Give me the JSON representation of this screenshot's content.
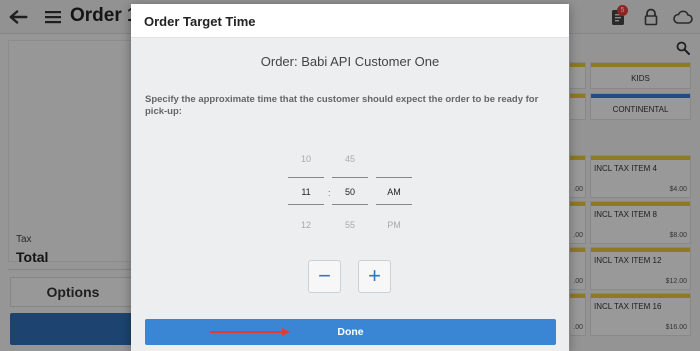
{
  "app": {
    "title": "Order 1",
    "notification_count": "5",
    "icons": [
      "back-arrow-icon",
      "hamburger-menu-icon",
      "clipboard-icon",
      "lock-icon",
      "cloud-icon",
      "search-icon"
    ]
  },
  "left_panel": {
    "tax_label": "Tax",
    "total_label": "Total",
    "options_button": "Options"
  },
  "categories": [
    {
      "name": "KIDS",
      "color": "#e8c33a"
    },
    {
      "name": "CONTINENTAL",
      "color": "#3a7bd5"
    }
  ],
  "items": [
    {
      "name": "INCL TAX ITEM 4",
      "price": "$4.00"
    },
    {
      "name": "INCL TAX ITEM 8",
      "price": "$8.00"
    },
    {
      "name": "INCL TAX ITEM 12",
      "price": "$12.00"
    },
    {
      "name": "INCL TAX ITEM 16",
      "price": "$16.00"
    }
  ],
  "left_partial_prices": [
    ".00",
    ".00",
    ".00",
    ".00"
  ],
  "dialog": {
    "title": "Order Target Time",
    "order_label": "Order: Babi API Customer One",
    "instructions": "Specify the approximate time that the customer should expect the order to be ready for pick-up:",
    "time_picker": {
      "hours": {
        "prev": "10",
        "selected": "11",
        "next": "12"
      },
      "separator": ":",
      "minutes": {
        "prev": "45",
        "selected": "50",
        "next": "55"
      },
      "period": {
        "prev": "",
        "selected": "AM",
        "next": "PM"
      }
    },
    "decrement_label": "−",
    "increment_label": "+",
    "done_label": "Done"
  },
  "colors": {
    "accent_blue": "#3b86d4",
    "dark_blue": "#2f6fb5",
    "annotation_arrow": "#e53935",
    "category_yellow": "#e8c33a"
  }
}
